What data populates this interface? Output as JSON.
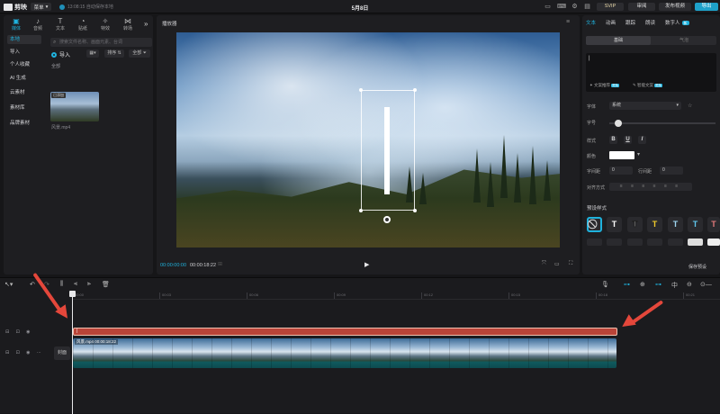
{
  "titlebar": {
    "app_name": "剪映",
    "menu_label": "菜单",
    "autosave_text": "13:08:15 自动保存本地",
    "doc_title": "5月8日",
    "svip_label": "SVIP",
    "review_label": "审阅",
    "publish_label": "发布视频",
    "export_label": "导出"
  },
  "left_tabs": [
    {
      "label": "媒体",
      "icon": "▣"
    },
    {
      "label": "音频",
      "icon": "♪"
    },
    {
      "label": "文本",
      "icon": "T"
    },
    {
      "label": "贴纸",
      "icon": "◔"
    },
    {
      "label": "特效",
      "icon": "✧"
    },
    {
      "label": "转场",
      "icon": "⋈"
    }
  ],
  "left_nav": [
    "本地",
    "导入",
    "个人收藏",
    "AI 生成",
    "云素材",
    "素材库",
    "品牌素材"
  ],
  "media": {
    "search_placeholder": "搜索文件名称、画面元素、台词",
    "import_label": "导入",
    "sort_label": "排序",
    "filter_label": "全部",
    "all_label": "全部",
    "thumb_badge": "已添加",
    "thumb_name": "风景.mp4"
  },
  "player": {
    "title": "播放器",
    "time_current": "00:00:00:00",
    "time_total": "00:00:18:22"
  },
  "right_tabs": [
    {
      "label": "文本",
      "new": false
    },
    {
      "label": "动画",
      "new": false
    },
    {
      "label": "跟踪",
      "new": false
    },
    {
      "label": "朗读",
      "new": false
    },
    {
      "label": "数字人",
      "new": true
    }
  ],
  "right": {
    "new_badge": "新",
    "subtab_basic": "基础",
    "subtab_bubble": "气泡",
    "text_value": "|",
    "opt_batch": "文案推荐",
    "opt_smart": "智能文案",
    "opt_tag": "限免",
    "font_label": "字体",
    "font_value": "系统",
    "size_label": "字号",
    "size_value": 0.05,
    "style_label": "样式",
    "style_b": "B",
    "style_u": "U",
    "style_i": "I",
    "color_label": "颜色",
    "color_value": "#ffffff",
    "spacing_label": "字间距",
    "spacing_value": "0",
    "line_label": "行间距",
    "line_value": "0",
    "align_label": "对齐方式",
    "align_icons": "≡ ≡ ≡ ≡ ≡ ≡",
    "preset_label": "预设样式",
    "save_preset": "保存预设"
  },
  "timeline": {
    "ticks": [
      "00:00",
      "00:03",
      "00:06",
      "00:09",
      "00:12",
      "00:15",
      "00:18",
      "00:21"
    ],
    "text_clip_label": "|",
    "video_clip_label": "风景.mp4  00:00:18:22",
    "cover_label": "封面"
  },
  "colors": {
    "accent": "#1fb2dd",
    "text_track": "#b94438",
    "arrow": "#e4473b"
  }
}
